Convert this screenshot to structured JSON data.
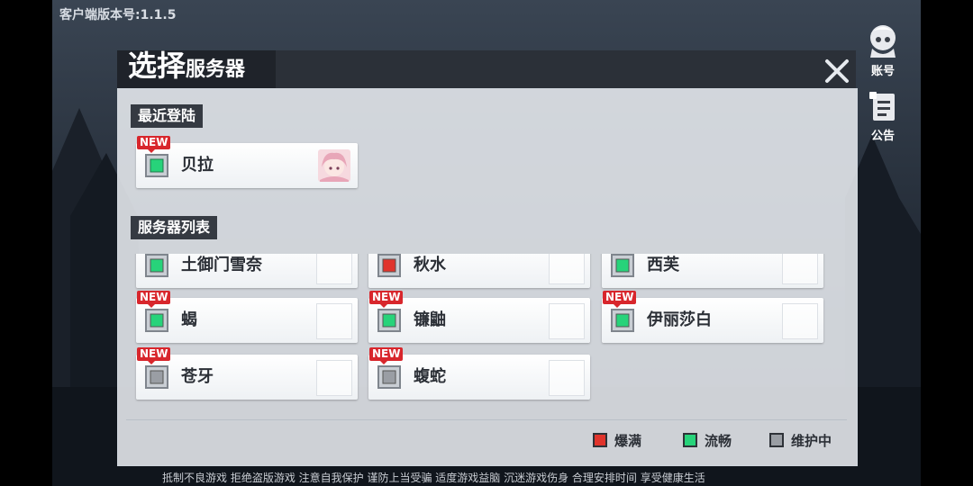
{
  "version_text": "客户端版本号:1.1.5",
  "footer_text": "抵制不良游戏  拒绝盗版游戏  注意自我保护  谨防上当受骗  适度游戏益脑  沉迷游戏伤身  合理安排时间  享受健康生活",
  "side": {
    "account_label": "账号",
    "notice_label": "公告"
  },
  "dialog": {
    "title_big": "选择",
    "title_small": "服务器"
  },
  "recent": {
    "label": "最近登陆",
    "server": {
      "name": "贝拉",
      "status": "green",
      "new": "NEW"
    }
  },
  "list": {
    "label": "服务器列表",
    "servers": [
      {
        "name": "土御门雪奈",
        "status": "green",
        "new": ""
      },
      {
        "name": "秋水",
        "status": "red",
        "new": ""
      },
      {
        "name": "西芙",
        "status": "green",
        "new": ""
      },
      {
        "name": "蝎",
        "status": "green",
        "new": "NEW"
      },
      {
        "name": "镰鼬",
        "status": "green",
        "new": "NEW"
      },
      {
        "name": "伊丽莎白",
        "status": "green",
        "new": "NEW"
      },
      {
        "name": "苍牙",
        "status": "gray",
        "new": "NEW"
      },
      {
        "name": "蝮蛇",
        "status": "gray",
        "new": "NEW"
      }
    ]
  },
  "legend": [
    {
      "label": "爆满",
      "color": "#e0342c"
    },
    {
      "label": "流畅",
      "color": "#27d37a"
    },
    {
      "label": "维护中",
      "color": "#9a9ea4"
    }
  ],
  "colors": {
    "red": "#e0342c",
    "green": "#27d37a",
    "gray": "#9a9ea4"
  }
}
